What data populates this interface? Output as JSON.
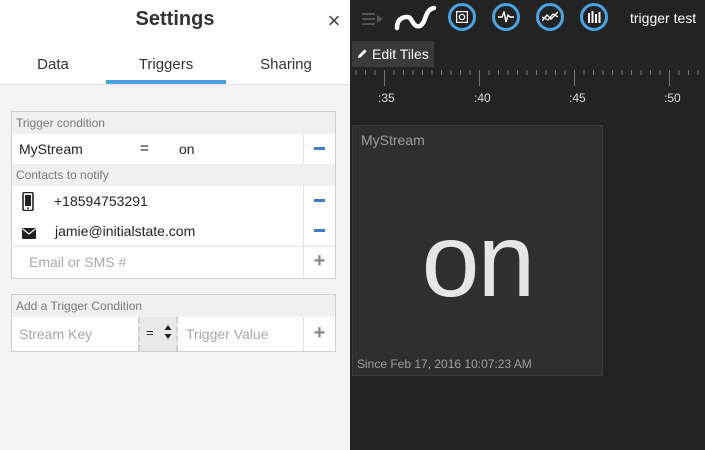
{
  "settings": {
    "title": "Settings",
    "close_icon": "×",
    "tabs": [
      "Data",
      "Triggers",
      "Sharing"
    ],
    "active_tab": "Triggers",
    "trigger_condition": {
      "header": "Trigger condition",
      "stream_key": "MyStream",
      "operator": "=",
      "value": "on"
    },
    "contacts": {
      "header": "Contacts to notify",
      "items": [
        {
          "type": "phone-icon",
          "value": "+18594753291"
        },
        {
          "type": "mail-icon",
          "value": "jamie@initialstate.com"
        }
      ],
      "placeholder": "Email or SMS #"
    },
    "add_condition": {
      "header": "Add a Trigger Condition",
      "stream_key_placeholder": "Stream Key",
      "operator": "=",
      "value_placeholder": "Trigger Value"
    }
  },
  "dashboard": {
    "title": "trigger test",
    "edit_tiles_label": "Edit Tiles",
    "accent_color": "#4aa3df",
    "timeline_labels": [
      ":35",
      ":40",
      ":45",
      ":50"
    ],
    "tile": {
      "name": "MyStream",
      "value": "on",
      "since": "Since Feb 17, 2016 10:07:23 AM"
    }
  }
}
